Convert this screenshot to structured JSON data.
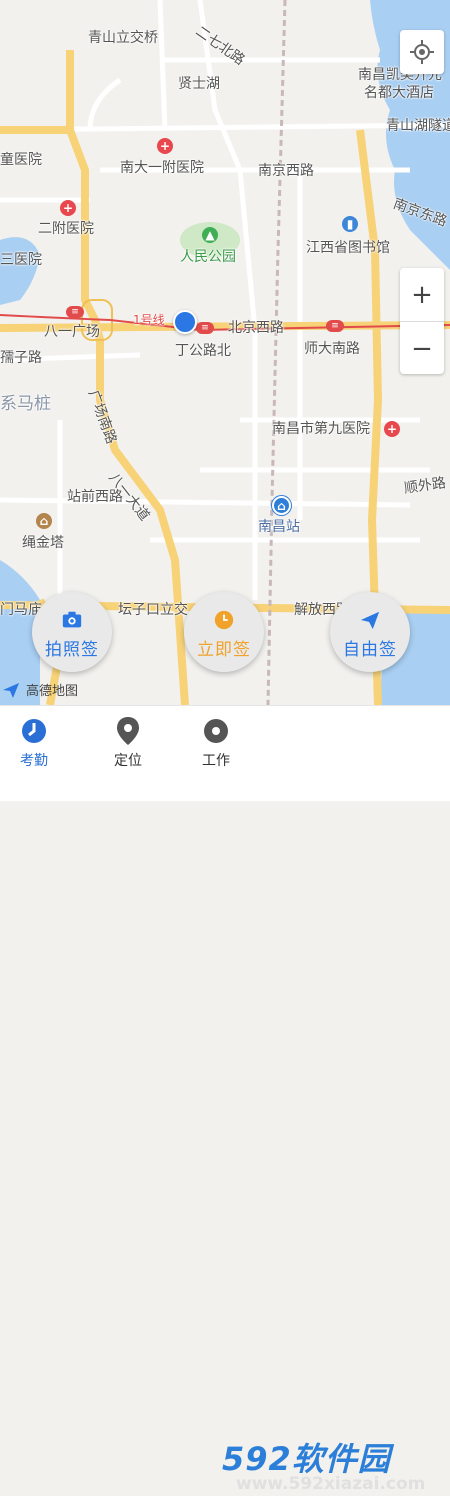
{
  "map": {
    "labels": {
      "qingshan_bridge": "青山立交桥",
      "erqibei": "二七北路",
      "xianshi_lake": "贤士湖",
      "hotel": "南昌凯美开元名都大酒店",
      "hotel_l1": "南昌凯美开元",
      "hotel_l2": "名都大酒店",
      "qingshanhu_tunnel": "青山湖隧道",
      "child_hospital": "童医院",
      "nanda_hospital": "南大一附医院",
      "nanjing_west": "南京西路",
      "nanjing_east": "南京东路",
      "second_hospital": "二附医院",
      "renmin_park": "人民公园",
      "library": "江西省图书馆",
      "third_hospital": "三医院",
      "bayi_square": "八一广场",
      "line1": "1号线",
      "beijing_west": "北京西路",
      "dinggong_north": "丁公路北",
      "shida_south": "师大南路",
      "ruzi_road": "孺子路",
      "guangchang_south": "广场南路",
      "ximazhuang": "系马桩",
      "ninth_hospital": "南昌市第九医院",
      "bayi_avenue": "八一大道",
      "shunwai_road": "顺外路",
      "zhanqian_west": "站前西路",
      "nanchang_station": "南昌站",
      "shengjin_tower": "绳金塔",
      "mamiao": "门马庙",
      "tanzikou": "坛子口立交",
      "jiefang_road": "解放西路",
      "gaode": "高德地图"
    }
  },
  "actions": {
    "photo_sign": "拍照签",
    "instant_sign": "立即签",
    "free_sign": "自由签"
  },
  "tabs": [
    {
      "label": "考勤",
      "icon": "clock-icon",
      "active": true
    },
    {
      "label": "定位",
      "icon": "location-pin-icon",
      "active": false
    },
    {
      "label": "工作",
      "icon": "work-icon",
      "active": false
    }
  ],
  "watermark": {
    "brand": "592软件园",
    "url": "www.592xiazai.com"
  },
  "colors": {
    "accent": "#2b78e4",
    "instant": "#f0a22b",
    "photo": "#2b78e4",
    "free": "#2b78e4",
    "hospital": "#e8474d",
    "metro_line": "#e24b4b"
  }
}
